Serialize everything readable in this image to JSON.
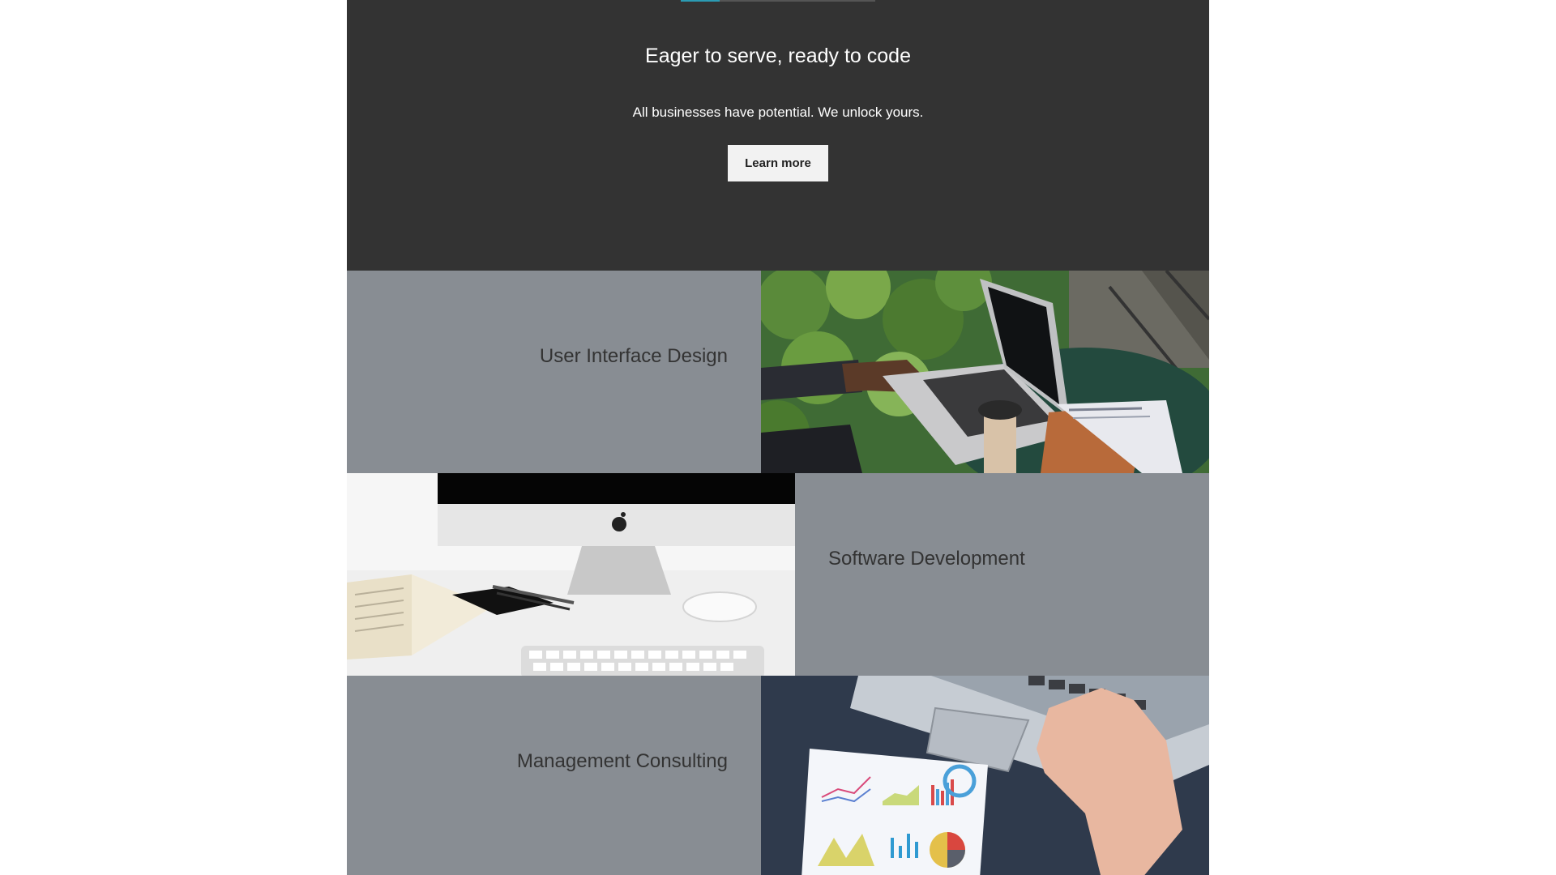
{
  "hero": {
    "title": "Eager to serve, ready to code",
    "subtitle": "All businesses have potential. We unlock yours.",
    "button_label": "Learn more",
    "accent_color": "#2b9bb3",
    "background_color": "#333333"
  },
  "services": [
    {
      "label": "User Interface Design",
      "image": "laptop-outdoor-photo"
    },
    {
      "label": "Software Development",
      "image": "desktop-workspace-photo"
    },
    {
      "label": "Management Consulting",
      "image": "laptop-charts-photo"
    }
  ],
  "colors": {
    "panel": "#888d93",
    "panel_text": "#333333"
  }
}
